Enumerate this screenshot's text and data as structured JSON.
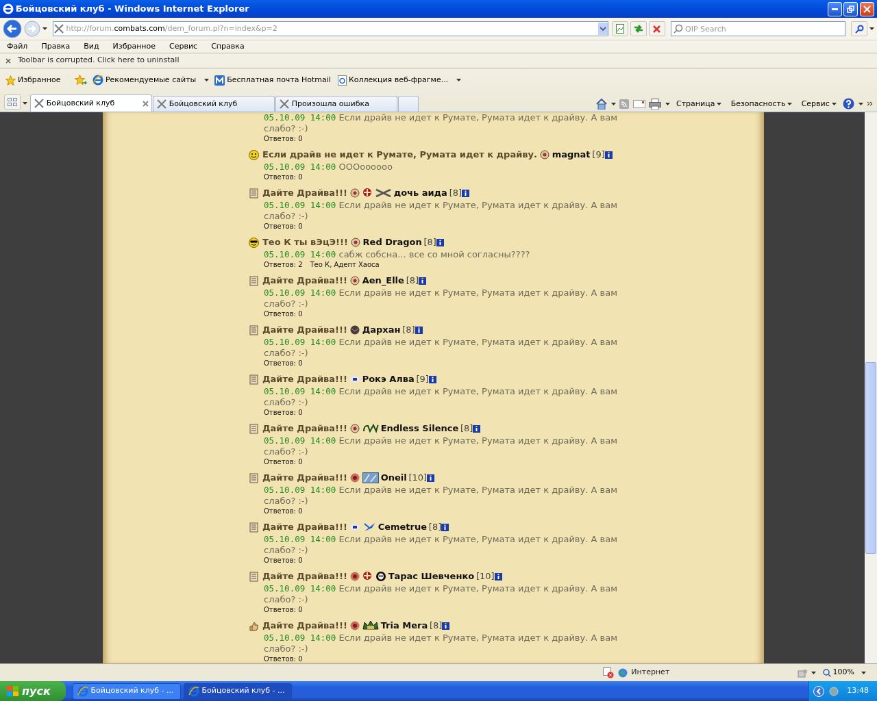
{
  "window": {
    "title": "Бойцовский клуб - Windows Internet Explorer"
  },
  "address_bar": {
    "url_host_prefix": "http://forum.",
    "url_host": "combats.com",
    "url_path": "/dem_forum.pl?n=index&p=2"
  },
  "search": {
    "placeholder": "QIP Search"
  },
  "menu": [
    "Файл",
    "Правка",
    "Вид",
    "Избранное",
    "Сервис",
    "Справка"
  ],
  "notice": "Toolbar is corrupted. Click here to uninstall",
  "favorites_bar": {
    "favorites": "Избранное",
    "links": [
      {
        "kind": "ie",
        "label": "Рекомендуемые сайты",
        "dropdown": true
      },
      {
        "kind": "mail",
        "label": "Бесплатная почта Hotmail",
        "dropdown": false
      },
      {
        "kind": "page",
        "label": "Коллекция веб-фрагме...",
        "dropdown": true
      }
    ]
  },
  "tabs": [
    {
      "label": "Бойцовский клуб",
      "selected": true
    },
    {
      "label": "Бойцовский клуб",
      "selected": false
    },
    {
      "label": "Произошла ошибка",
      "selected": false
    }
  ],
  "command_bar": [
    "Страница",
    "Безопасность",
    "Сервис"
  ],
  "posts": [
    {
      "kind": "partial",
      "date": "05.10.09 14:00",
      "text": "Если драйв не идет к Румате, Румата идет к драйву. А вам слабо? :-)",
      "replies": "Ответов: 0"
    },
    {
      "kind": "post",
      "title": "Если драйв не идет к Румате, Румата идет к драйву.",
      "author": "magnat",
      "level": "[9]",
      "date": "05.10.09 14:00",
      "text": "OOOoooooo",
      "replies": "Ответов: 0"
    },
    {
      "kind": "post",
      "title": "Дайте Драйва!!!",
      "author": "дочь аида",
      "level": "[8]",
      "date": "05.10.09 14:00",
      "text": "Если драйв не идет к Румате, Румата идет к драйву. А вам слабо? :-)",
      "replies": "Ответов: 0"
    },
    {
      "kind": "post",
      "title": "Тео К ты вЭцЭ!!!",
      "author": "Red Dragon",
      "level": "[8]",
      "date": "05.10.09 14:00",
      "text": "сабж собсна... все со мной согласны????",
      "replies": "Ответов: 2",
      "repliers": "Тео К, Адепт Хаоса"
    },
    {
      "kind": "post",
      "title": "Дайте Драйва!!!",
      "author": "Aen_Elle",
      "level": "[8]",
      "date": "05.10.09 14:00",
      "text": "Если драйв не идет к Румате, Румата идет к драйву. А вам слабо? :-)",
      "replies": "Ответов: 0"
    },
    {
      "kind": "post",
      "title": "Дайте Драйва!!!",
      "author": "Дархан",
      "level": "[8]",
      "date": "05.10.09 14:00",
      "text": "Если драйв не идет к Румате, Румата идет к драйву. А вам слабо? :-)",
      "replies": "Ответов: 0"
    },
    {
      "kind": "post",
      "title": "Дайте Драйва!!!",
      "author": "Рокэ Алва",
      "level": "[9]",
      "date": "05.10.09 14:00",
      "text": "Если драйв не идет к Румате, Румата идет к драйву. А вам слабо? :-)",
      "replies": "Ответов: 0"
    },
    {
      "kind": "post",
      "title": "Дайте Драйва!!!",
      "author": "Endless Silence",
      "level": "[8]",
      "date": "05.10.09 14:00",
      "text": "Если драйв не идет к Румате, Румата идет к драйву. А вам слабо? :-)",
      "replies": "Ответов: 0"
    },
    {
      "kind": "post",
      "title": "Дайте Драйва!!!",
      "author": "Oneil",
      "level": "[10]",
      "date": "05.10.09 14:00",
      "text": "Если драйв не идет к Румате, Румата идет к драйву. А вам слабо? :-)",
      "replies": "Ответов: 0"
    },
    {
      "kind": "post",
      "title": "Дайте Драйва!!!",
      "author": "Cemetrue",
      "level": "[8]",
      "date": "05.10.09 14:00",
      "text": "Если драйв не идет к Румате, Румата идет к драйву. А вам слабо? :-)",
      "replies": "Ответов: 0"
    },
    {
      "kind": "post",
      "title": "Дайте Драйва!!!",
      "author": "Тарас Шевченко",
      "level": "[10]",
      "date": "05.10.09 14:00",
      "text": "Если драйв не идет к Румате, Румата идет к драйву. А вам слабо? :-)",
      "replies": "Ответов: 0"
    },
    {
      "kind": "post",
      "title": "Дайте Драйва!!!",
      "author": "Tria Mera",
      "level": "[8]",
      "date": "05.10.09 14:00",
      "text": "Если драйв не идет к Румате, Румата идет к драйву. А вам слабо? :-)",
      "replies": "Ответов: 0"
    }
  ],
  "status_bar": {
    "zone": "Интернет",
    "zoom": "100%"
  },
  "taskbar": {
    "start": "пуск",
    "buttons": [
      {
        "label": "Бойцовский клуб - ...",
        "selected": false
      },
      {
        "label": "Бойцовский клуб - ...",
        "selected": true
      }
    ],
    "clock": "13:48"
  }
}
